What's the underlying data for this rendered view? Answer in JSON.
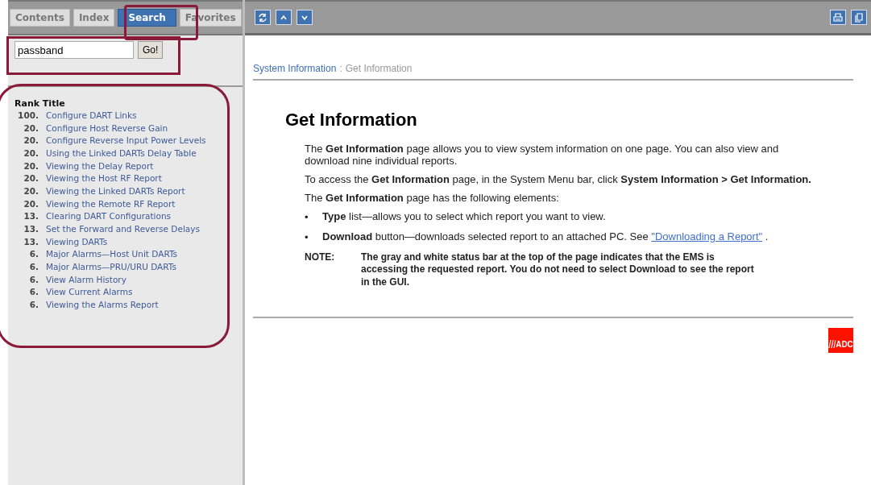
{
  "tabs": [
    {
      "label": "Contents",
      "selected": false
    },
    {
      "label": "Index",
      "selected": false
    },
    {
      "label": "Search",
      "selected": true
    },
    {
      "label": "Favorites",
      "selected": false
    }
  ],
  "search": {
    "value": "passband",
    "button": "Go!"
  },
  "results": {
    "header": "Rank Title",
    "rows": [
      {
        "rank": "100.",
        "title": "Configure DART Links"
      },
      {
        "rank": "20.",
        "title": "Configure Host Reverse Gain"
      },
      {
        "rank": "20.",
        "title": "Configure Reverse Input Power Levels"
      },
      {
        "rank": "20.",
        "title": "Using the Linked DARTs Delay Table"
      },
      {
        "rank": "20.",
        "title": "Viewing the Delay Report"
      },
      {
        "rank": "20.",
        "title": "Viewing the Host RF Report"
      },
      {
        "rank": "20.",
        "title": "Viewing the Linked DARTs Report"
      },
      {
        "rank": "20.",
        "title": "Viewing the Remote RF Report"
      },
      {
        "rank": "13.",
        "title": "Clearing DART Configurations"
      },
      {
        "rank": "13.",
        "title": "Set the Forward and Reverse Delays"
      },
      {
        "rank": "13.",
        "title": "Viewing DARTs"
      },
      {
        "rank": "6.",
        "title": "Major Alarms—Host Unit DARTs"
      },
      {
        "rank": "6.",
        "title": "Major Alarms—PRU/URU DARTs"
      },
      {
        "rank": "6.",
        "title": "View Alarm History"
      },
      {
        "rank": "6.",
        "title": "View Current Alarms"
      },
      {
        "rank": "6.",
        "title": "Viewing the Alarms Report"
      }
    ]
  },
  "breadcrumb": {
    "parent": "System Information",
    "separator": ":",
    "current": "Get Information"
  },
  "heading": "Get Information",
  "paragraphs": [
    "The **Get Information** page allows you to view system information on one page. You can also view and download nine individual reports.",
    "To access the **Get Information** page, in the System Menu bar, click **System Information > Get Information.**",
    "The **Get Information** page has the following elements:"
  ],
  "bullets": [
    {
      "marker": "•",
      "text": "**Type** list—allows you to select which report you want to view."
    },
    {
      "marker": "•",
      "text": "**Download** button—downloads selected report to an attached PC. See ",
      "link": "\"Downloading a Report\"",
      "after": " ."
    }
  ],
  "note": {
    "label": "NOTE:",
    "text": "The gray and white status bar at the top of the page indicates that the EMS is accessing the requested report. You do not need to select Download to see the report in the GUI."
  },
  "logo": "ADC"
}
